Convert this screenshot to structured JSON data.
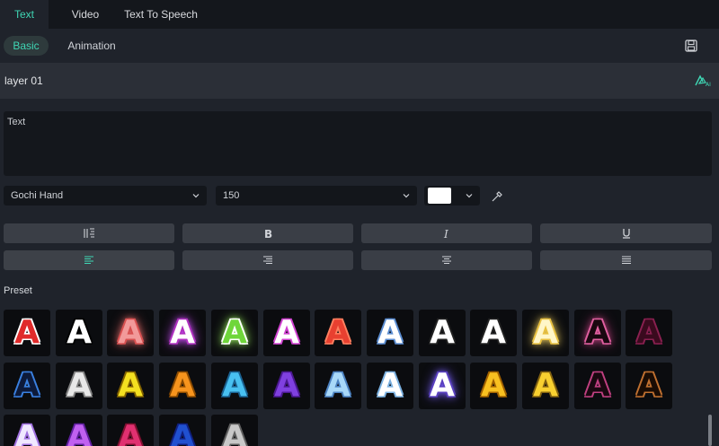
{
  "tabs": [
    {
      "label": "Text",
      "active": true
    },
    {
      "label": "Video",
      "active": false
    },
    {
      "label": "Text To Speech",
      "active": false
    }
  ],
  "subtabs": [
    {
      "label": "Basic",
      "active": true
    },
    {
      "label": "Animation",
      "active": false
    }
  ],
  "layer": {
    "name": "layer 01"
  },
  "text_input": {
    "value": "Text"
  },
  "font": {
    "family": "Gochi Hand",
    "size": "150",
    "color": "#ffffff"
  },
  "style_buttons": [
    {
      "name": "text-columns",
      "icon": "columns-icon"
    },
    {
      "name": "bold",
      "icon": "bold-icon"
    },
    {
      "name": "italic",
      "icon": "italic-icon"
    },
    {
      "name": "underline",
      "icon": "underline-icon"
    }
  ],
  "align_buttons": [
    {
      "name": "align-left",
      "icon": "align-left-icon",
      "active": true
    },
    {
      "name": "align-right",
      "icon": "align-right-icon"
    },
    {
      "name": "align-center",
      "icon": "align-center-icon"
    },
    {
      "name": "align-justify",
      "icon": "align-justify-icon"
    }
  ],
  "preset": {
    "label": "Preset",
    "letter": "A",
    "rows": [
      [
        {
          "fill": "#e02a2a",
          "stroke": "#ffffff",
          "glow": ""
        },
        {
          "fill": "#ffffff",
          "stroke": "#000000",
          "glow": ""
        },
        {
          "fill": "#f29a9a",
          "stroke": "#d85050",
          "glow": "#f07070"
        },
        {
          "fill": "#ffffff",
          "stroke": "#b030c0",
          "glow": "#d050ff"
        },
        {
          "fill": "#6fd63a",
          "stroke": "#ffffff",
          "glow": "#a0ff60"
        },
        {
          "fill": "#ffffff",
          "stroke": "#d040d0",
          "glow": ""
        },
        {
          "fill": "#e84030",
          "stroke": "#ff8060",
          "glow": ""
        },
        {
          "fill": "#ffffff",
          "stroke": "#5a8cd0",
          "glow": ""
        },
        {
          "fill": "#ffffff",
          "stroke": "#222222",
          "glow": ""
        },
        {
          "fill": "#ffffff",
          "stroke": "#222222",
          "glow": ""
        },
        {
          "fill": "#fff6c8",
          "stroke": "#e8c040",
          "glow": "#f0d060"
        },
        {
          "fill": "#1a0810",
          "stroke": "#e060a0",
          "glow": "#c04080"
        },
        {
          "fill": "#3a0a1e",
          "stroke": "#8a2050",
          "glow": ""
        }
      ],
      [
        {
          "fill": "#0d1a3a",
          "stroke": "#3a80e0",
          "glow": ""
        },
        {
          "fill": "#e8e8e8",
          "stroke": "#808080",
          "glow": ""
        },
        {
          "fill": "#f4e020",
          "stroke": "#806000",
          "glow": ""
        },
        {
          "fill": "#f7941d",
          "stroke": "#8a4a00",
          "glow": ""
        },
        {
          "fill": "#48c0f0",
          "stroke": "#1a6090",
          "glow": ""
        },
        {
          "fill": "#8040e0",
          "stroke": "#4a1890",
          "glow": ""
        },
        {
          "fill": "#a8d8f8",
          "stroke": "#4a80c0",
          "glow": ""
        },
        {
          "fill": "#ffffff",
          "stroke": "#7ab0e0",
          "glow": ""
        },
        {
          "fill": "#ffffff",
          "stroke": "#5a40c0",
          "glow": "#7a60ff"
        },
        {
          "fill": "#f8c020",
          "stroke": "#a06000",
          "glow": ""
        },
        {
          "fill": "#f8d030",
          "stroke": "#806010",
          "glow": ""
        },
        {
          "fill": "#1a0810",
          "stroke": "#c04080",
          "glow": ""
        },
        {
          "fill": "#1a0c04",
          "stroke": "#c07030",
          "glow": ""
        }
      ],
      [
        {
          "fill": "#f0e8ff",
          "stroke": "#a070e0",
          "glow": ""
        },
        {
          "fill": "#c060f0",
          "stroke": "#6020a0",
          "glow": ""
        },
        {
          "fill": "#e03070",
          "stroke": "#801030",
          "glow": ""
        },
        {
          "fill": "#2050d0",
          "stroke": "#102080",
          "glow": ""
        },
        {
          "fill": "#c8c8c8",
          "stroke": "#606060",
          "glow": ""
        }
      ]
    ]
  }
}
